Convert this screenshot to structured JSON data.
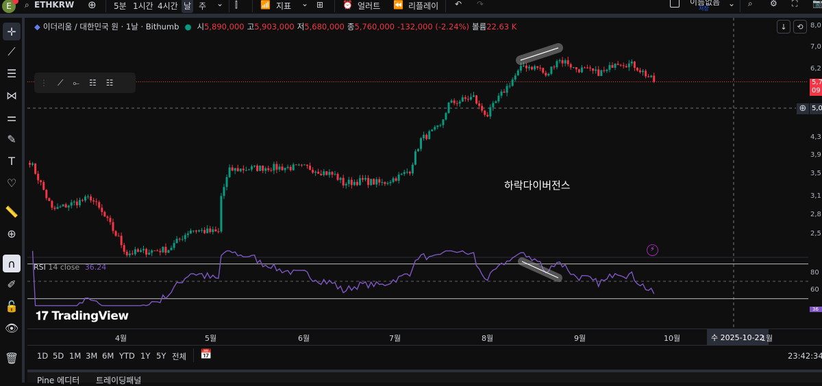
{
  "topbar": {
    "avatar": "E",
    "symbol": "ETHKRW",
    "intervals": [
      "5분",
      "1시간",
      "4시간",
      "날",
      "주"
    ],
    "indicators": "지표",
    "alert": "얼러트",
    "replay": "리플레이",
    "layout_name": "이름없음",
    "save": "저장"
  },
  "legend": {
    "title": "이더리움 / 대한민국 원 · 1날 · Bithumb",
    "o_label": "시",
    "o": "5,890,000",
    "h_label": "고",
    "h": "5,903,000",
    "l_label": "저",
    "l": "5,680,000",
    "c_label": "종",
    "c": "5,760,000",
    "change": "-132,000 (-2.24%)",
    "vol_label": "볼륨",
    "vol": "22.63 K"
  },
  "annotation": "하락다이버전스",
  "watermark": "TradingView",
  "rsi": {
    "label": "RSI",
    "params": "14 close",
    "value": "36.24",
    "upper": 70,
    "middle": 50,
    "lower": 30
  },
  "price_axis": [
    "8,0",
    "7,0",
    "6,2",
    "5,0",
    "4,3",
    "3,9",
    "3,5",
    "3,1",
    "2,8",
    "2,5"
  ],
  "price_tag": {
    "value": "5,7",
    "sub": "09",
    "crosshair": "5,0"
  },
  "rsi_axis": [
    "80",
    "60",
    "40"
  ],
  "rsi_tag": "36",
  "time_axis": [
    "4월",
    "5월",
    "6월",
    "7월",
    "8월",
    "9월",
    "10월",
    "1월"
  ],
  "crosshair_date": "수 2025-10-22",
  "ranges": [
    "1D",
    "5D",
    "1M",
    "3M",
    "6M",
    "YTD",
    "1Y",
    "5Y",
    "전체"
  ],
  "clock": "23:42:34",
  "bottom_tabs": [
    "Pine 에디터",
    "트레이딩패널"
  ],
  "colors": {
    "up": "#089981",
    "down": "#f23645",
    "rsi": "#7e57c2",
    "bg": "#0f0f0f"
  },
  "chart_data": {
    "type": "candlestick",
    "scale": "log",
    "ylim": [
      2500000,
      8000000
    ],
    "waypoints": [
      [
        0,
        3730
      ],
      [
        8,
        2850
      ],
      [
        22,
        3050
      ],
      [
        35,
        2250
      ],
      [
        50,
        2300
      ],
      [
        58,
        2560
      ],
      [
        68,
        2520
      ],
      [
        68.5,
        3000
      ],
      [
        72,
        3550
      ],
      [
        85,
        3600
      ],
      [
        100,
        3600
      ],
      [
        110,
        3450
      ],
      [
        113,
        3300
      ],
      [
        120,
        3350
      ],
      [
        127,
        3300
      ],
      [
        134,
        3450
      ],
      [
        137,
        3550
      ],
      [
        141,
        4200
      ],
      [
        148,
        4500
      ],
      [
        151,
        5100
      ],
      [
        160,
        5300
      ],
      [
        162,
        5000
      ],
      [
        165,
        4800
      ],
      [
        168,
        5150
      ],
      [
        172,
        5600
      ],
      [
        178,
        6300
      ],
      [
        184,
        6200
      ],
      [
        186,
        5900
      ],
      [
        190,
        6500
      ],
      [
        194,
        6400
      ],
      [
        196,
        6200
      ],
      [
        200,
        6150
      ],
      [
        204,
        6050
      ],
      [
        208,
        6100
      ],
      [
        211,
        6450
      ],
      [
        218,
        6300
      ],
      [
        222,
        6000
      ],
      [
        225,
        5760
      ]
    ]
  }
}
